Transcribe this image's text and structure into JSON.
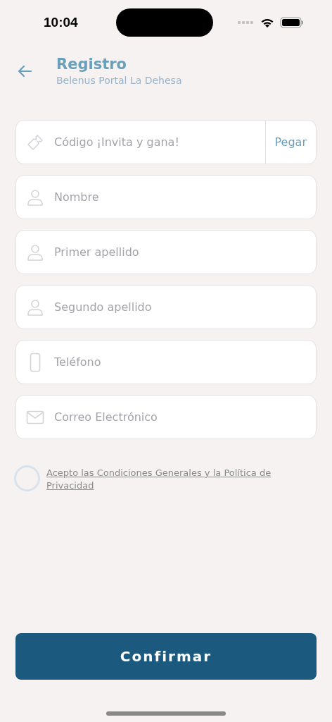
{
  "status_bar": {
    "time": "10:04"
  },
  "header": {
    "title": "Registro",
    "subtitle": "Belenus Portal La Dehesa"
  },
  "fields": [
    {
      "kind": "ticket",
      "placeholder": "Código ¡Invita y gana!",
      "action": "Pegar"
    },
    {
      "kind": "person",
      "placeholder": "Nombre"
    },
    {
      "kind": "person",
      "placeholder": "Primer apellido"
    },
    {
      "kind": "person",
      "placeholder": "Segundo apellido"
    },
    {
      "kind": "phone",
      "placeholder": "Teléfono"
    },
    {
      "kind": "mail",
      "placeholder": "Correo Electrónico"
    }
  ],
  "terms": {
    "checked": false,
    "label": "Acepto las Condiciones Generales y la Política de Privacidad"
  },
  "confirm_button": "Confirmar"
}
